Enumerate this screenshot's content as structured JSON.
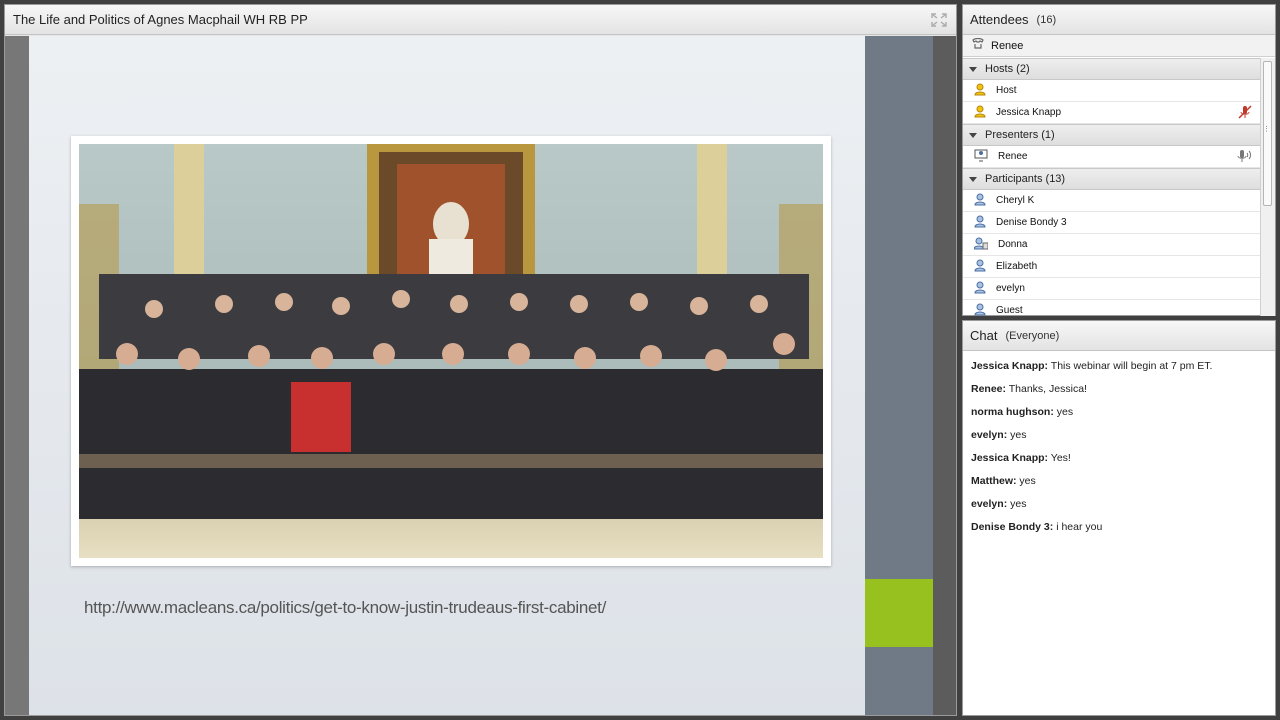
{
  "main_pod": {
    "title": "The Life and Politics of Agnes Macphail WH RB PP",
    "slide_link": "http://www.macleans.ca/politics/get-to-know-justin-trudeaus-first-cabinet/"
  },
  "attendees": {
    "title": "Attendees",
    "count": "(16)",
    "me": "Renee",
    "groups": [
      {
        "label": "Hosts (2)",
        "members": [
          "Host",
          "Jessica Knapp"
        ]
      },
      {
        "label": "Presenters (1)",
        "members": [
          "Renee"
        ]
      },
      {
        "label": "Participants (13)",
        "members": [
          "Cheryl K",
          "Denise Bondy 3",
          "Donna",
          "Elizabeth",
          "evelyn",
          "Guest"
        ]
      }
    ]
  },
  "chat": {
    "title": "Chat",
    "scope": "(Everyone)",
    "messages": [
      {
        "who": "Jessica Knapp:",
        "text": "This webinar will begin at 7 pm ET."
      },
      {
        "who": "Renee:",
        "text": "Thanks, Jessica!"
      },
      {
        "who": "norma hughson:",
        "text": "yes"
      },
      {
        "who": "evelyn:",
        "text": "yes"
      },
      {
        "who": "Jessica Knapp:",
        "text": "Yes!"
      },
      {
        "who": "Matthew:",
        "text": "yes"
      },
      {
        "who": "evelyn:",
        "text": "yes"
      },
      {
        "who": "Denise Bondy 3:",
        "text": "i hear you"
      }
    ]
  },
  "colors": {
    "accent_green": "#96c11f",
    "slide_side": "#6f7a86"
  },
  "icons": [
    "fullscreen-icon",
    "phone-icon",
    "host-icon",
    "mic-off-icon",
    "presenter-icon",
    "speaker-mic-icon",
    "participant-icon"
  ]
}
